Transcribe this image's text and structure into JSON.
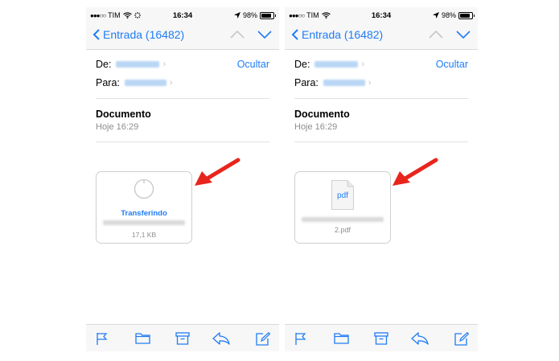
{
  "screens": [
    {
      "status": {
        "carrier": "TIM",
        "time": "16:34",
        "battery": "98%"
      },
      "nav": {
        "back_label": "Entrada (16482)"
      },
      "header": {
        "from_label": "De:",
        "to_label": "Para:",
        "hide_label": "Ocultar"
      },
      "message": {
        "subject": "Documento",
        "date": "Hoje 16:29"
      },
      "attachment": {
        "status": "Transferindo",
        "size": "17,1 KB"
      }
    },
    {
      "status": {
        "carrier": "TIM",
        "time": "16:34",
        "battery": "98%"
      },
      "nav": {
        "back_label": "Entrada (16482)"
      },
      "header": {
        "from_label": "De:",
        "to_label": "Para:",
        "hide_label": "Ocultar"
      },
      "message": {
        "subject": "Documento",
        "date": "Hoje 16:29"
      },
      "attachment": {
        "file_type": "pdf",
        "filename_suffix": "2.pdf"
      }
    }
  ],
  "colors": {
    "accent": "#1f7cf6",
    "annotation_arrow": "#e8251c"
  },
  "icons": [
    "signal-dots-icon",
    "wifi-icon",
    "location-icon",
    "battery-icon",
    "chevron-left-icon",
    "chevron-up-icon",
    "chevron-down-icon",
    "flag-icon",
    "folder-icon",
    "archive-icon",
    "reply-icon",
    "compose-icon",
    "pdf-file-icon",
    "progress-ring-icon"
  ]
}
